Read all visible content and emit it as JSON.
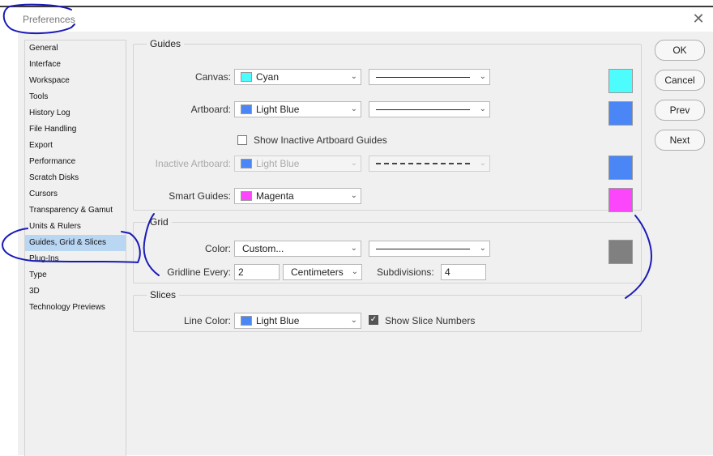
{
  "window": {
    "title": "Preferences",
    "close_glyph": "✕"
  },
  "sidebar": {
    "items": [
      {
        "label": "General"
      },
      {
        "label": "Interface"
      },
      {
        "label": "Workspace"
      },
      {
        "label": "Tools"
      },
      {
        "label": "History Log"
      },
      {
        "label": "File Handling"
      },
      {
        "label": "Export"
      },
      {
        "label": "Performance"
      },
      {
        "label": "Scratch Disks"
      },
      {
        "label": "Cursors"
      },
      {
        "label": "Transparency & Gamut"
      },
      {
        "label": "Units & Rulers"
      },
      {
        "label": "Guides, Grid & Slices"
      },
      {
        "label": "Plug-Ins"
      },
      {
        "label": "Type"
      },
      {
        "label": "3D"
      },
      {
        "label": "Technology Previews"
      }
    ],
    "selected_label": "Guides, Grid & Slices"
  },
  "buttons": {
    "ok": "OK",
    "cancel": "Cancel",
    "prev": "Prev",
    "next": "Next"
  },
  "guides": {
    "title": "Guides",
    "canvas": {
      "label": "Canvas:",
      "color": "Cyan",
      "swatch": "#4dfcfc"
    },
    "artboard": {
      "label": "Artboard:",
      "color": "Light Blue",
      "swatch": "#4a86f5"
    },
    "show_inactive": {
      "label": "Show Inactive Artboard Guides",
      "checked": false
    },
    "inactive_artboard": {
      "label": "Inactive Artboard:",
      "color": "Light Blue",
      "swatch": "#4a86f5"
    },
    "smart_guides": {
      "label": "Smart Guides:",
      "color": "Magenta",
      "swatch": "#fc46fc"
    }
  },
  "grid": {
    "title": "Grid",
    "color": {
      "label": "Color:",
      "value": "Custom...",
      "swatch": "#808080"
    },
    "gridline_every": {
      "label": "Gridline Every:",
      "value": "2",
      "unit": "Centimeters"
    },
    "subdivisions": {
      "label": "Subdivisions:",
      "value": "4"
    }
  },
  "slices": {
    "title": "Slices",
    "line_color": {
      "label": "Line Color:",
      "value": "Light Blue",
      "swatch": "#4a86f5"
    },
    "show_numbers": {
      "label": "Show Slice Numbers",
      "checked": true
    }
  },
  "icons": {
    "chevron": "chevron-down-icon",
    "check": "checkmark-icon",
    "close": "close-icon"
  },
  "colors": {
    "selection": "#b9d6f3",
    "annotation": "#1a1ab8",
    "dialog_bg": "#f0f0f0"
  }
}
